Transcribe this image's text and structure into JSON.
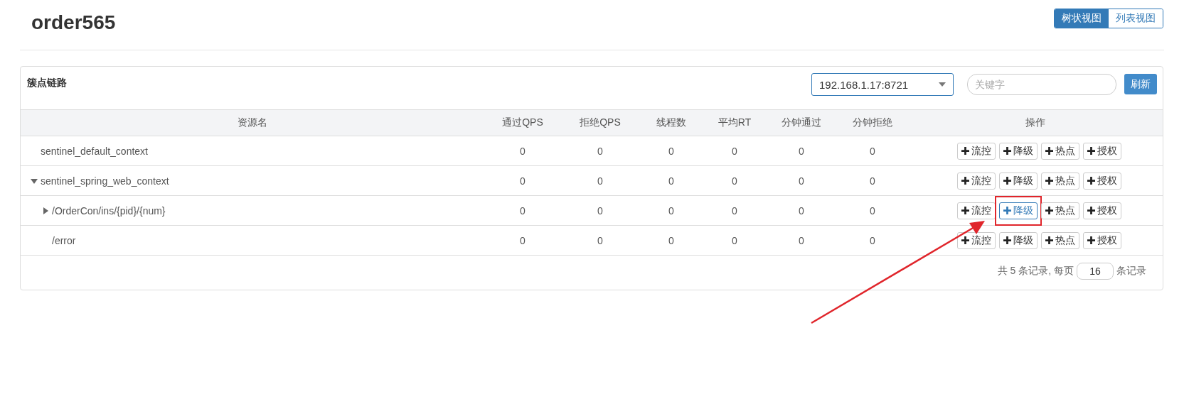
{
  "page": {
    "title": "order565"
  },
  "view_tabs": [
    {
      "label": "树状视图",
      "selected": true
    },
    {
      "label": "列表视图",
      "selected": false
    }
  ],
  "panel": {
    "title": "簇点链路",
    "machine_select": {
      "value": "192.168.1.17:8721"
    },
    "search": {
      "placeholder": "关键字"
    },
    "refresh_button": "刷新"
  },
  "table": {
    "columns": [
      "资源名",
      "通过QPS",
      "拒绝QPS",
      "线程数",
      "平均RT",
      "分钟通过",
      "分钟拒绝",
      "操作"
    ],
    "rows": [
      {
        "name": "sentinel_default_context",
        "values": [
          "0",
          "0",
          "0",
          "0",
          "0",
          "0"
        ],
        "actions": [
          {
            "label": "流控",
            "highlighted": false,
            "marked": false
          },
          {
            "label": "降级",
            "highlighted": false,
            "marked": false
          },
          {
            "label": "热点",
            "highlighted": false,
            "marked": false
          },
          {
            "label": "授权",
            "highlighted": false,
            "marked": false
          }
        ]
      },
      {
        "name": "sentinel_spring_web_context",
        "expanded": true,
        "values": [
          "0",
          "0",
          "0",
          "0",
          "0",
          "0"
        ],
        "actions": [
          {
            "label": "流控",
            "highlighted": false,
            "marked": false
          },
          {
            "label": "降级",
            "highlighted": false,
            "marked": false
          },
          {
            "label": "热点",
            "highlighted": false,
            "marked": false
          },
          {
            "label": "授权",
            "highlighted": false,
            "marked": false
          }
        ],
        "children": [
          {
            "name": "/OrderCon/ins/{pid}/{num}",
            "expanded": false,
            "values": [
              "0",
              "0",
              "0",
              "0",
              "0",
              "0"
            ],
            "actions": [
              {
                "label": "流控",
                "highlighted": false,
                "marked": false
              },
              {
                "label": "降级",
                "highlighted": true,
                "marked": true
              },
              {
                "label": "热点",
                "highlighted": false,
                "marked": false
              },
              {
                "label": "授权",
                "highlighted": false,
                "marked": false
              }
            ]
          },
          {
            "name": "/error",
            "values": [
              "0",
              "0",
              "0",
              "0",
              "0",
              "0"
            ],
            "actions": [
              {
                "label": "流控",
                "highlighted": false,
                "marked": false
              },
              {
                "label": "降级",
                "highlighted": false,
                "marked": false
              },
              {
                "label": "热点",
                "highlighted": false,
                "marked": false
              },
              {
                "label": "授权",
                "highlighted": false,
                "marked": false
              }
            ]
          }
        ]
      }
    ]
  },
  "pagination": {
    "summary": "共 5 条记录, 每页",
    "page_size": "16",
    "suffix": "条记录"
  }
}
